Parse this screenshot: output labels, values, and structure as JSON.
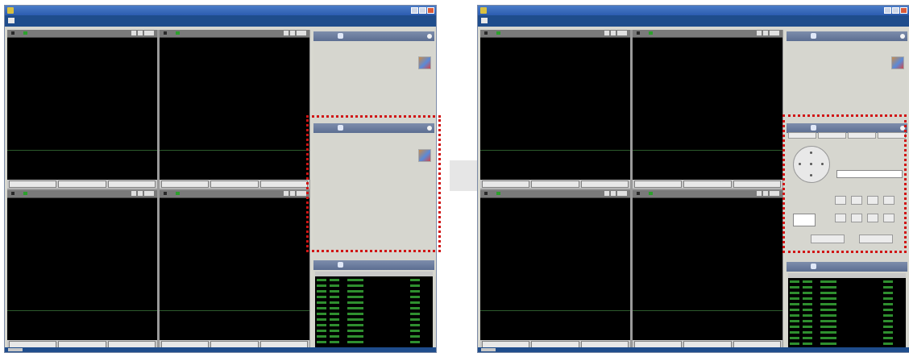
{
  "left": {
    "window_title": "",
    "toolbar_text": "",
    "cameras": [
      {
        "title": "",
        "status": "",
        "status2": "",
        "right_status": "",
        "right_status2": "",
        "buttons": [
          "",
          "",
          ""
        ]
      },
      {
        "title": "",
        "status": "",
        "status2": "",
        "right_status": "",
        "right_status2": "",
        "buttons": [
          "",
          "",
          ""
        ]
      },
      {
        "title": "",
        "status": "",
        "status2": "",
        "right_status": "",
        "right_status2": "",
        "buttons": [
          "",
          "",
          ""
        ]
      },
      {
        "title": "",
        "status": "",
        "status2": "",
        "right_status": "",
        "right_status2": "",
        "buttons": [
          "",
          "",
          ""
        ]
      }
    ],
    "side": {
      "panel1": {
        "title": "",
        "info": [
          "",
          "",
          "",
          "",
          ""
        ]
      },
      "panel2": {
        "title": "",
        "info": [
          "",
          "",
          "",
          "",
          ""
        ]
      },
      "log": {
        "title": "",
        "columns": [
          "",
          "",
          "",
          ""
        ],
        "rows": 12
      }
    }
  },
  "right": {
    "window_title": "",
    "toolbar_text": "",
    "side": {
      "panel1": {
        "title": "",
        "info": [
          "",
          "",
          "",
          "",
          ""
        ]
      },
      "panel2": {
        "title": "",
        "tabs": [
          "",
          "",
          "",
          ""
        ],
        "labels": [
          "",
          "",
          "",
          ""
        ]
      },
      "log": {
        "title": "",
        "columns": [
          "",
          "",
          "",
          ""
        ],
        "rows": 12
      }
    }
  },
  "colors": {
    "accent": "#2c5cb0",
    "highlight_border": "#d01414",
    "video_bg": "#000000",
    "overlay_text": "#34c234",
    "arrow": "#e6e6e6"
  }
}
